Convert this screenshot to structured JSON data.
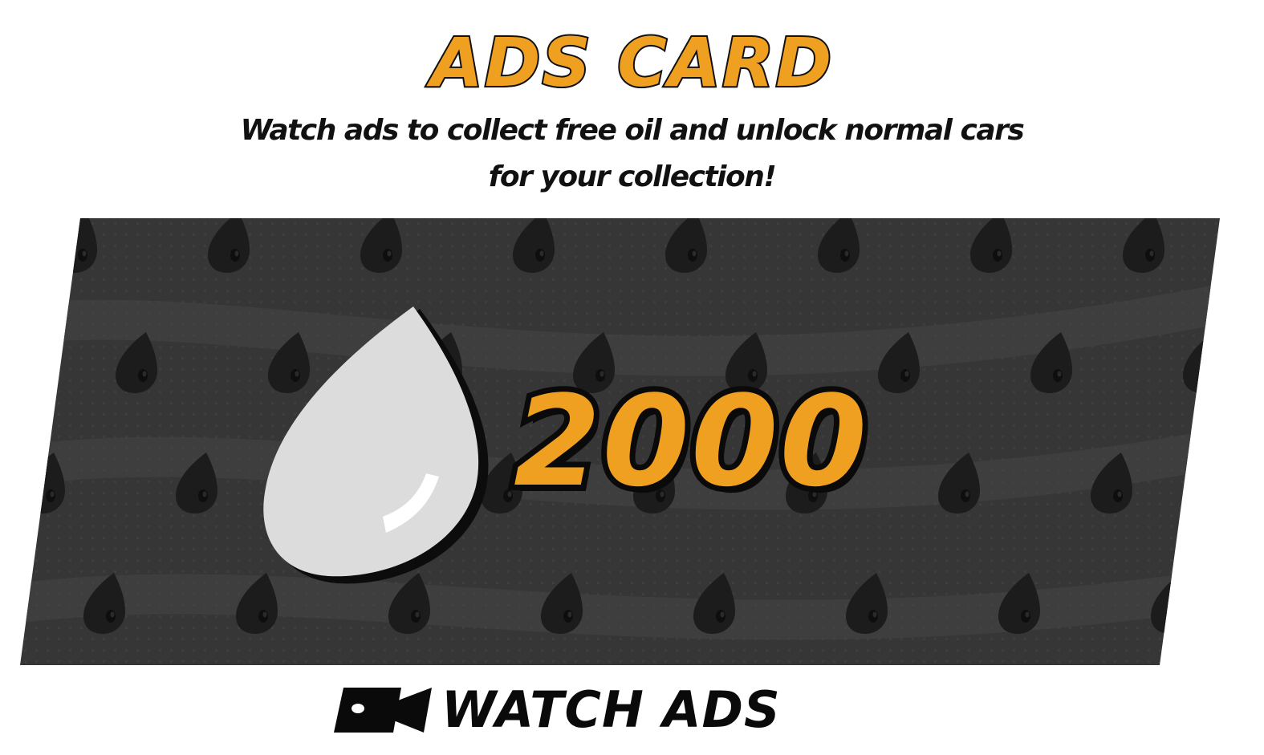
{
  "header": {
    "title": "ADS CARD",
    "subtitle_line1": "Watch ads to collect free oil and unlock normal cars",
    "subtitle_line2": "for your collection!"
  },
  "reward": {
    "amount": "2000",
    "icon": "oil-drop-icon",
    "color": "#f0a020"
  },
  "action": {
    "label": "WATCH ADS",
    "icon": "video-camera-icon"
  },
  "colors": {
    "accent": "#f0a020",
    "card_background": "#3a3a3a",
    "text": "#111111"
  }
}
